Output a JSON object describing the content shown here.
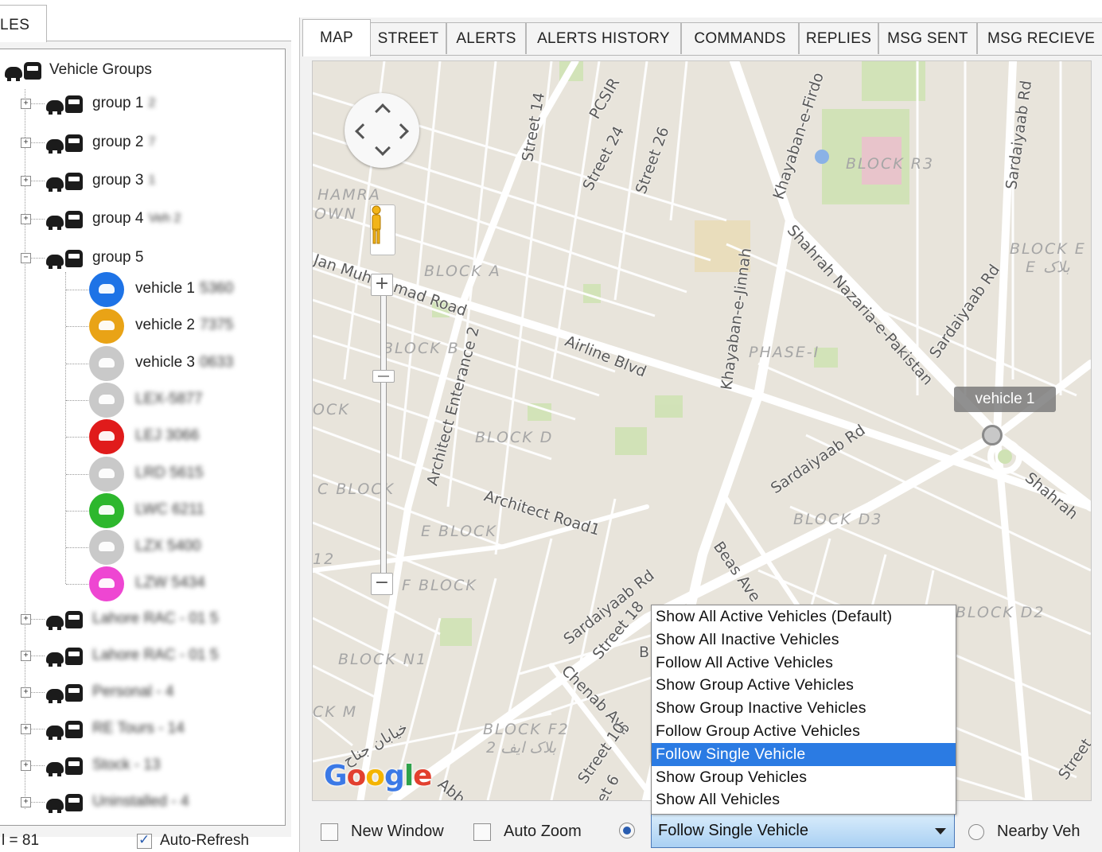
{
  "left_panel": {
    "tab_label": "LES",
    "tree_root": "Vehicle Groups",
    "groups": [
      {
        "label": "group 1",
        "suffix": "2"
      },
      {
        "label": "group 2",
        "suffix": "7"
      },
      {
        "label": "group 3",
        "suffix": "1"
      },
      {
        "label": "group 4",
        "suffix": "Veh 2"
      },
      {
        "label": "group 5",
        "suffix": ""
      }
    ],
    "vehicles": [
      {
        "label": "vehicle 1",
        "suffix": "5360",
        "color": "#1e73e6"
      },
      {
        "label": "vehicle 2",
        "suffix": "7375",
        "color": "#e9a316"
      },
      {
        "label": "vehicle 3",
        "suffix": "0633",
        "color": "#c9c9c9"
      },
      {
        "label": "",
        "suffix": "LEX-5877",
        "color": "#c9c9c9"
      },
      {
        "label": "",
        "suffix": "LEJ 3066",
        "color": "#e01b1b"
      },
      {
        "label": "",
        "suffix": "LRD 5615",
        "color": "#c9c9c9"
      },
      {
        "label": "",
        "suffix": "LWC 6211",
        "color": "#2db72d"
      },
      {
        "label": "",
        "suffix": "LZX 5400",
        "color": "#c9c9c9"
      },
      {
        "label": "",
        "suffix": "LZW 5434",
        "color": "#ee46d2"
      }
    ],
    "more_groups": [
      {
        "label": "Lahore RAC - 01 5"
      },
      {
        "label": "Lahore RAC - 01 5"
      },
      {
        "label": "Personal - 4"
      },
      {
        "label": "RE Tours - 14"
      },
      {
        "label": "Stock - 13"
      },
      {
        "label": "Uninstalled - 4"
      }
    ],
    "status_text": "l = 81",
    "auto_refresh_label": "Auto-Refresh",
    "auto_refresh_checked": true
  },
  "tabs": [
    {
      "label": "MAP",
      "active": true
    },
    {
      "label": "STREET"
    },
    {
      "label": "ALERTS"
    },
    {
      "label": "ALERTS HISTORY"
    },
    {
      "label": "COMMANDS"
    },
    {
      "label": "REPLIES"
    },
    {
      "label": "MSG SENT"
    },
    {
      "label": "MSG RECIEVE"
    }
  ],
  "map": {
    "vehicle_marker_label": "vehicle 1",
    "zoom_in": "+",
    "zoom_out": "−",
    "zoom_minus_small": "−",
    "google": "Google",
    "labels": {
      "street14": "Street 14",
      "pcsir": "PCSIR",
      "street24": "Street 24",
      "street26": "Street 26",
      "khayaban_firdousi": "Khayaban-e-Firdo",
      "block_r3": "BLOCK R3",
      "sardaiyaab_top": "Sardaiyaab Rd",
      "hamra": "HAMRA",
      "town": "OWN",
      "jan_muhammad": "Jan Muhammad Road",
      "block_a": "BLOCK A",
      "shahrah_nazaria": "Shahrah Nazaria-e-Pakistan",
      "block_e": "BLOCK E",
      "block_e_urdu": "E بلاک",
      "sardaiyaab_right": "Sardaiyaab Rd",
      "airline_blvd": "Airline Blvd",
      "block_b": "BLOCK B",
      "architect_entrance": "Architect Enterance 2",
      "khayaban_jinnah": "Khayaban-e-Jinnah",
      "phase1": "PHASE-I",
      "ock": "OCK",
      "block_d": "BLOCK D",
      "sardaiyaab_mid": "Sardaiyaab Rd",
      "shahrah_right": "Shahrah",
      "c_block": "C BLOCK",
      "architect_road": "Architect Road1",
      "block_d3": "BLOCK D3",
      "beas_ave": "Beas Ave",
      "e_block": "E BLOCK",
      "num12": "12",
      "f_block": "F BLOCK",
      "sardaiyaab_low": "Sardaiyaab Rd",
      "street18": "Street 18",
      "block_d2": "BLOCK D2",
      "block_n1": "BLOCK N1",
      "chenab_ave": "Chenab Ave",
      "ck_m": "CK M",
      "block_f2": "BLOCK F2",
      "block_f2_urdu": "بلاک ایف 2",
      "khayaban_urdu": "خیابان جناح",
      "street10": "Street 10",
      "street_right": "Street",
      "street6": "et 6",
      "abba": "Abb",
      "b_letter": "B"
    }
  },
  "mode_dropdown": {
    "options": [
      "Show All Active Vehicles (Default)",
      "Show All Inactive Vehicles",
      "Follow All Active Vehicles",
      "Show Group Active Vehicles",
      "Show Group Inactive Vehicles",
      "Follow Group Active Vehicles",
      "Follow Single Vehicle",
      "Show Group Vehicles",
      "Show All Vehicles"
    ],
    "selected": "Follow Single Vehicle"
  },
  "toolbar": {
    "new_window_label": "New Window",
    "auto_zoom_label": "Auto Zoom",
    "nearby_label": "Nearby Veh"
  }
}
